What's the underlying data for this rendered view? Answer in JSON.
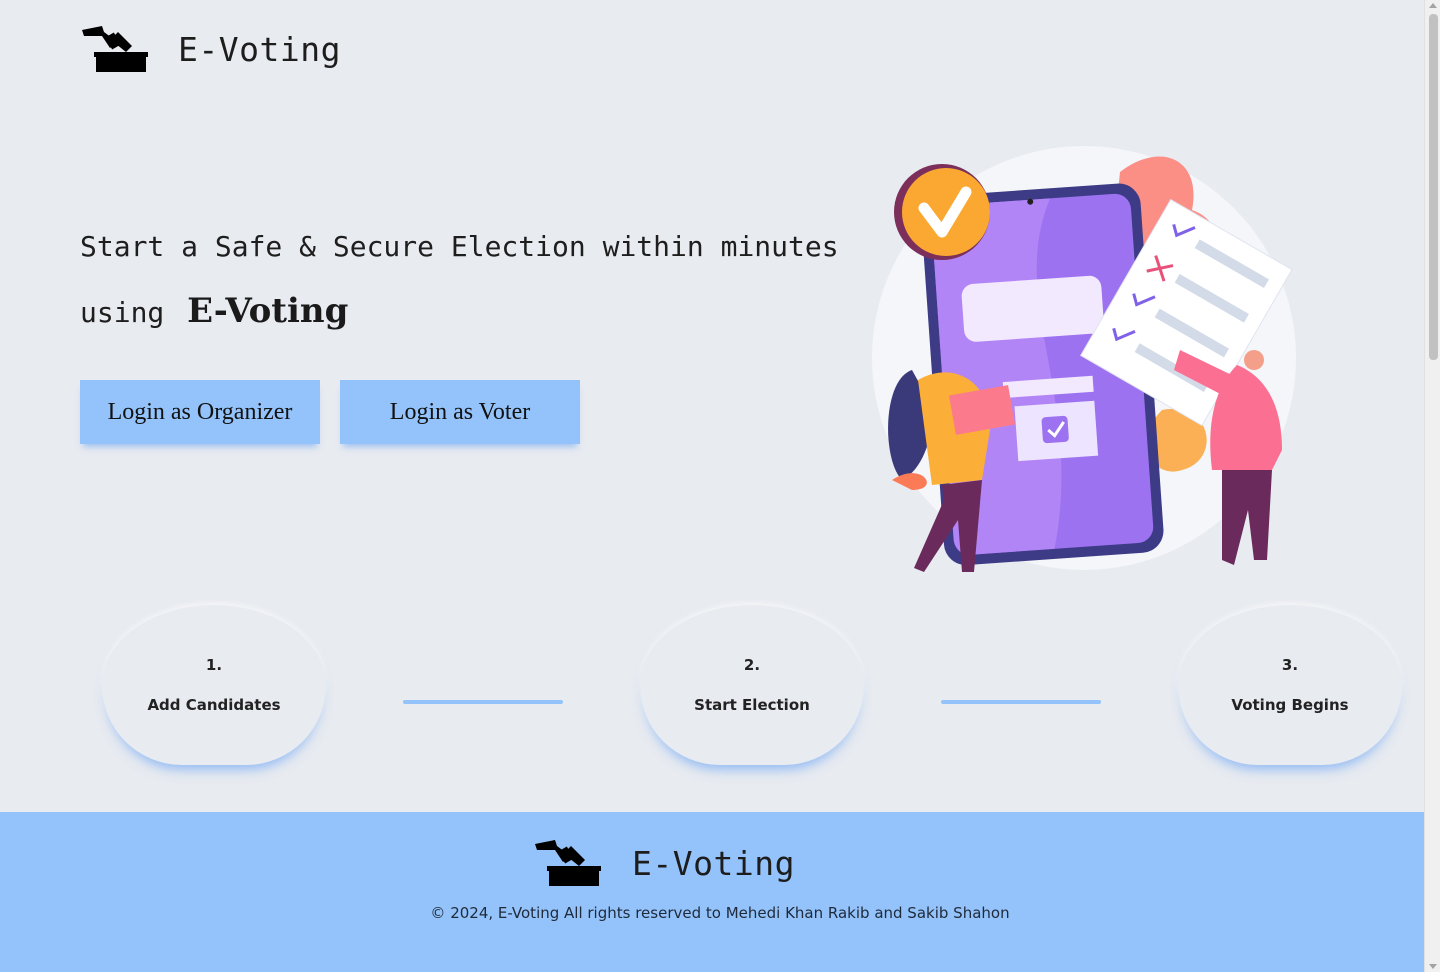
{
  "header": {
    "logo_icon": "ballot-box-icon",
    "brand": "E-Voting"
  },
  "hero": {
    "line1": "Start a Safe & Secure Election within minutes",
    "line2_prefix": "using",
    "line2_brand": "E-Voting"
  },
  "buttons": {
    "organizer": "Login as Organizer",
    "voter": "Login as Voter"
  },
  "illustration": {
    "icon": "voting-phone-illustration"
  },
  "steps": [
    {
      "number": "1.",
      "label": "Add Candidates"
    },
    {
      "number": "2.",
      "label": "Start Election"
    },
    {
      "number": "3.",
      "label": "Voting Begins"
    }
  ],
  "footer": {
    "brand": "E-Voting",
    "copyright": "© 2024, E-Voting All rights reserved to Mehedi Khan Rakib and Sakib Shahon"
  },
  "colors": {
    "background": "#e8ebf0",
    "accent": "#93c3fa",
    "text": "#1e1e1e"
  }
}
